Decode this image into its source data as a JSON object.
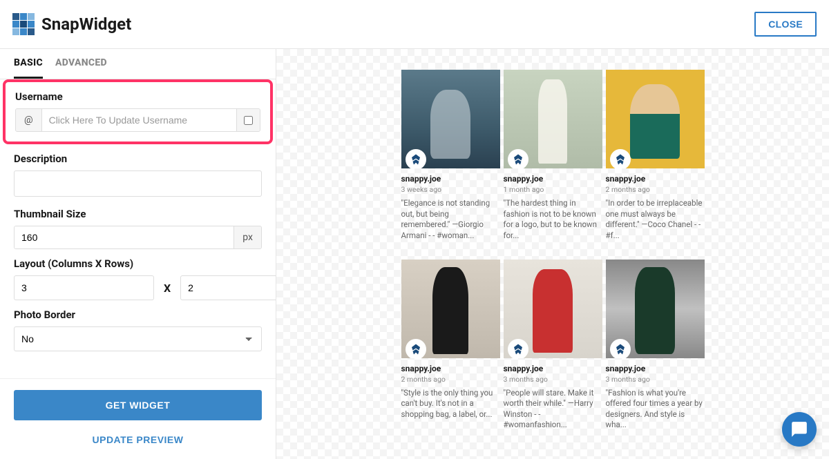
{
  "header": {
    "brand": "SnapWidget",
    "close_label": "CLOSE"
  },
  "tabs": {
    "basic": "BASIC",
    "advanced": "ADVANCED"
  },
  "form": {
    "username_label": "Username",
    "username_prefix": "@",
    "username_placeholder": "Click Here To Update Username",
    "description_label": "Description",
    "thumbnail_label": "Thumbnail Size",
    "thumbnail_value": "160",
    "thumbnail_suffix": "px",
    "layout_label": "Layout (Columns X Rows)",
    "layout_cols": "3",
    "layout_x": "X",
    "layout_rows": "2",
    "border_label": "Photo Border",
    "border_value": "No"
  },
  "footer": {
    "get_widget": "GET WIDGET",
    "update_preview": "UPDATE PREVIEW"
  },
  "posts": [
    {
      "user": "snappy.joe",
      "time": "3 weeks ago",
      "caption": "\"Elegance is not standing out, but being remembered.\" —Giorgio Armani - - #woman..."
    },
    {
      "user": "snappy.joe",
      "time": "1 month ago",
      "caption": "\"The hardest thing in fashion is not to be known for a logo, but to be known for..."
    },
    {
      "user": "snappy.joe",
      "time": "2 months ago",
      "caption": "\"In order to be irreplaceable one must always be different.\" —Coco Chanel - - #f..."
    },
    {
      "user": "snappy.joe",
      "time": "2 months ago",
      "caption": "\"Style is the only thing you can't buy. It's not in a shopping bag, a label, or..."
    },
    {
      "user": "snappy.joe",
      "time": "3 months ago",
      "caption": "\"People will stare. Make it worth their while.\" —Harry Winston - - #womanfashion..."
    },
    {
      "user": "snappy.joe",
      "time": "3 months ago",
      "caption": "\"Fashion is what you're offered four times a year by designers. And style is wha..."
    }
  ]
}
